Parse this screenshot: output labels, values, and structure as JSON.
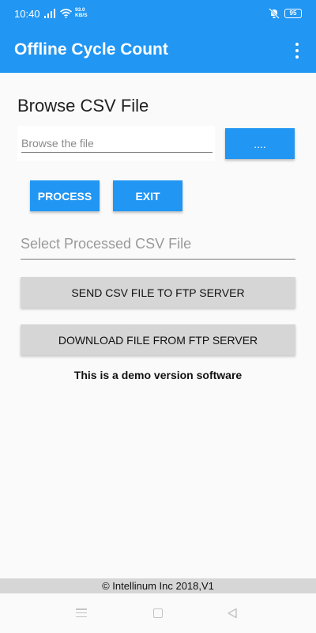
{
  "status_bar": {
    "time": "10:40",
    "speed_value": "93.0",
    "speed_unit": "KB/S",
    "battery": "95"
  },
  "app_bar": {
    "title": "Offline Cycle Count"
  },
  "browse": {
    "heading": "Browse CSV File",
    "input_placeholder": "Browse the file",
    "input_value": "",
    "browse_button_label": "...."
  },
  "actions": {
    "process_label": "PROCESS",
    "exit_label": "EXIT"
  },
  "processed": {
    "placeholder": "Select Processed CSV File"
  },
  "ftp": {
    "send_label": "SEND CSV FILE TO FTP SERVER",
    "download_label": "DOWNLOAD FILE FROM FTP SERVER"
  },
  "demo_notice": "This is a demo version software",
  "footer": "© Intellinum Inc 2018,V1",
  "colors": {
    "primary": "#2196f3",
    "button_grey": "#d6d6d6"
  },
  "icons": [
    "signal-icon",
    "wifi-icon",
    "mute-icon",
    "battery-icon",
    "overflow-menu-icon",
    "nav-menu-icon",
    "nav-home-icon",
    "nav-back-icon"
  ]
}
